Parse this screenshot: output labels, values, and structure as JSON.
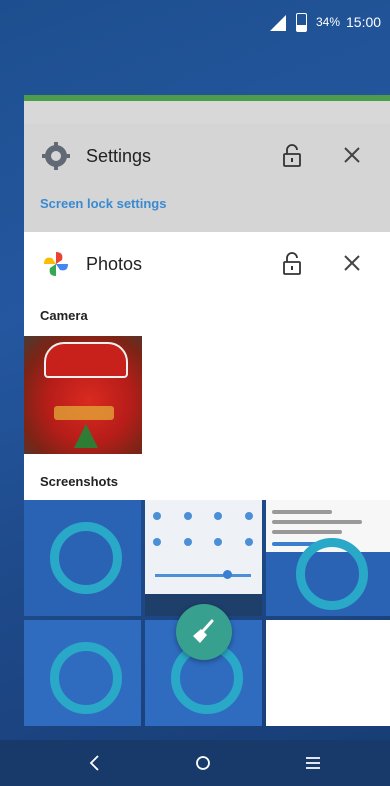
{
  "status_bar": {
    "battery": "34%",
    "time": "15:00"
  },
  "recents": {
    "settings_card": {
      "title": "Settings",
      "subtitle": "Screen lock settings"
    },
    "photos_card": {
      "title": "Photos",
      "albums": [
        {
          "label": "Camera"
        },
        {
          "label": "Screenshots"
        }
      ]
    }
  },
  "icons": {
    "settings": "gear-icon",
    "photos": "pinwheel-icon",
    "lock": "lock-icon",
    "close": "close-icon",
    "clear_all": "broom-icon",
    "nav_back": "back-icon",
    "nav_home": "home-icon",
    "nav_recents": "menu-icon"
  },
  "colors": {
    "wallpaper": "#2457a0",
    "accent_link": "#3a8ad2",
    "fab": "#37a08f"
  }
}
